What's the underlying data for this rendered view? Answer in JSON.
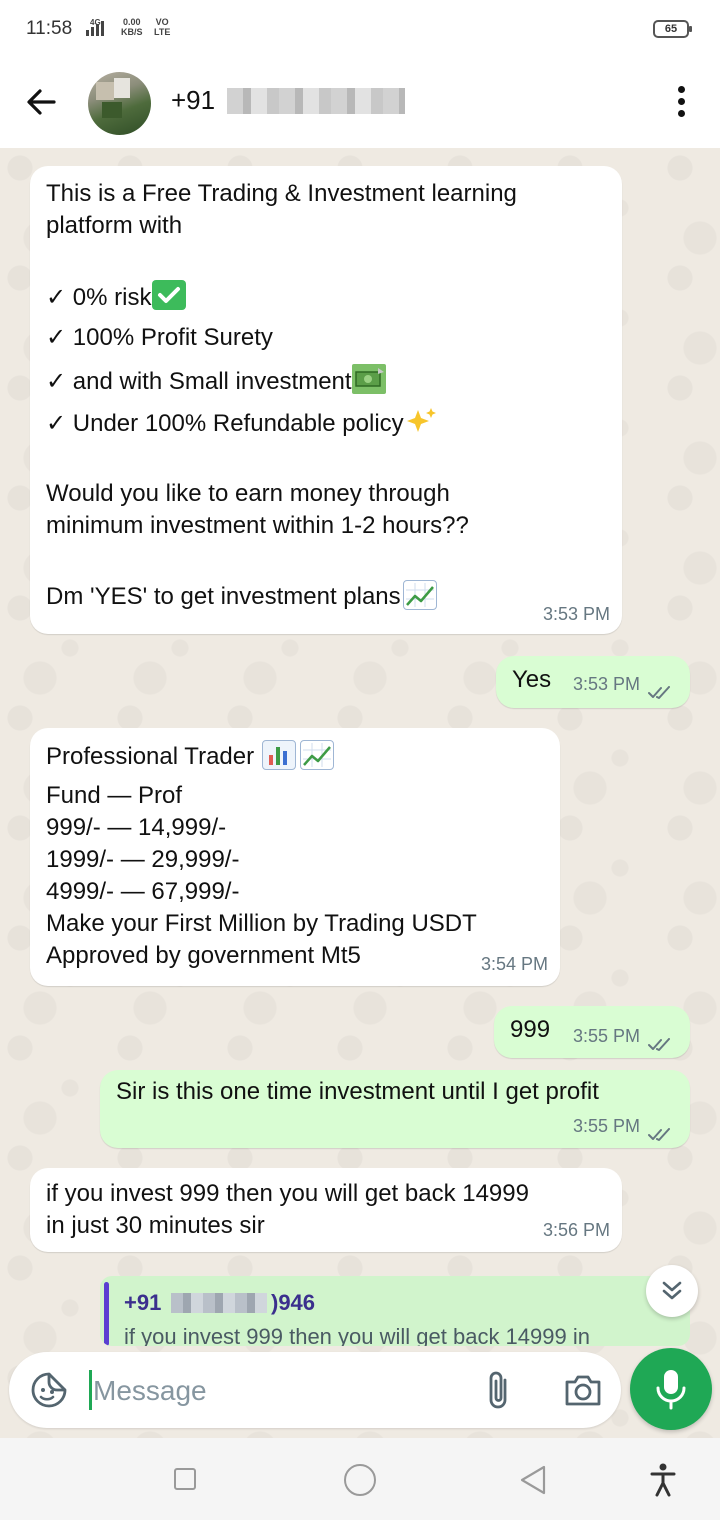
{
  "status_bar": {
    "time": "11:58",
    "network": "4G",
    "speed_value": "0.00",
    "speed_unit": "KB/S",
    "volte_top": "VO",
    "volte_bottom": "LTE",
    "battery": "65"
  },
  "header": {
    "contact_prefix": "+91"
  },
  "messages": [
    {
      "id": "m1",
      "direction": "incoming",
      "paragraphs": [
        "This is a Free Trading & Investment learning",
        "platform with"
      ],
      "checks": [
        "0% risk",
        "100% Profit Surety",
        "and with Small investment",
        "Under 100% Refundable policy"
      ],
      "question": [
        "Would you like to earn money through",
        "minimum investment within 1-2 hours??"
      ],
      "cta": "Dm 'YES' to get investment plans",
      "time": "3:53 PM"
    },
    {
      "id": "m2",
      "direction": "outgoing",
      "text": "Yes",
      "time": "3:53 PM"
    },
    {
      "id": "m3",
      "direction": "incoming",
      "heading": "Professional Trader",
      "lines": [
        "Fund — Prof",
        "999/- — 14,999/-",
        "1999/- — 29,999/-",
        "4999/- — 67,999/-",
        "Make your First Million by Trading USDT",
        "Approved by government Mt5"
      ],
      "time": "3:54 PM"
    },
    {
      "id": "m4",
      "direction": "outgoing",
      "text": "999",
      "time": "3:55 PM"
    },
    {
      "id": "m5",
      "direction": "outgoing",
      "text": "Sir is this one time investment until I get profit",
      "time": "3:55 PM"
    },
    {
      "id": "m6",
      "direction": "incoming",
      "lines": [
        "if you invest 999 then you will get back 14999",
        "in just 30 minutes sir"
      ],
      "time": "3:56 PM"
    }
  ],
  "reply_preview": {
    "name_prefix": "+91",
    "name_suffix": ")946",
    "text": "if you invest 999 then you will get back 14999 in"
  },
  "composer": {
    "placeholder": "Message"
  },
  "colors": {
    "accent": "#1fa855",
    "incoming_bubble": "#ffffff",
    "outgoing_bubble": "#d9fdd3",
    "chat_bg": "#efeae2"
  }
}
